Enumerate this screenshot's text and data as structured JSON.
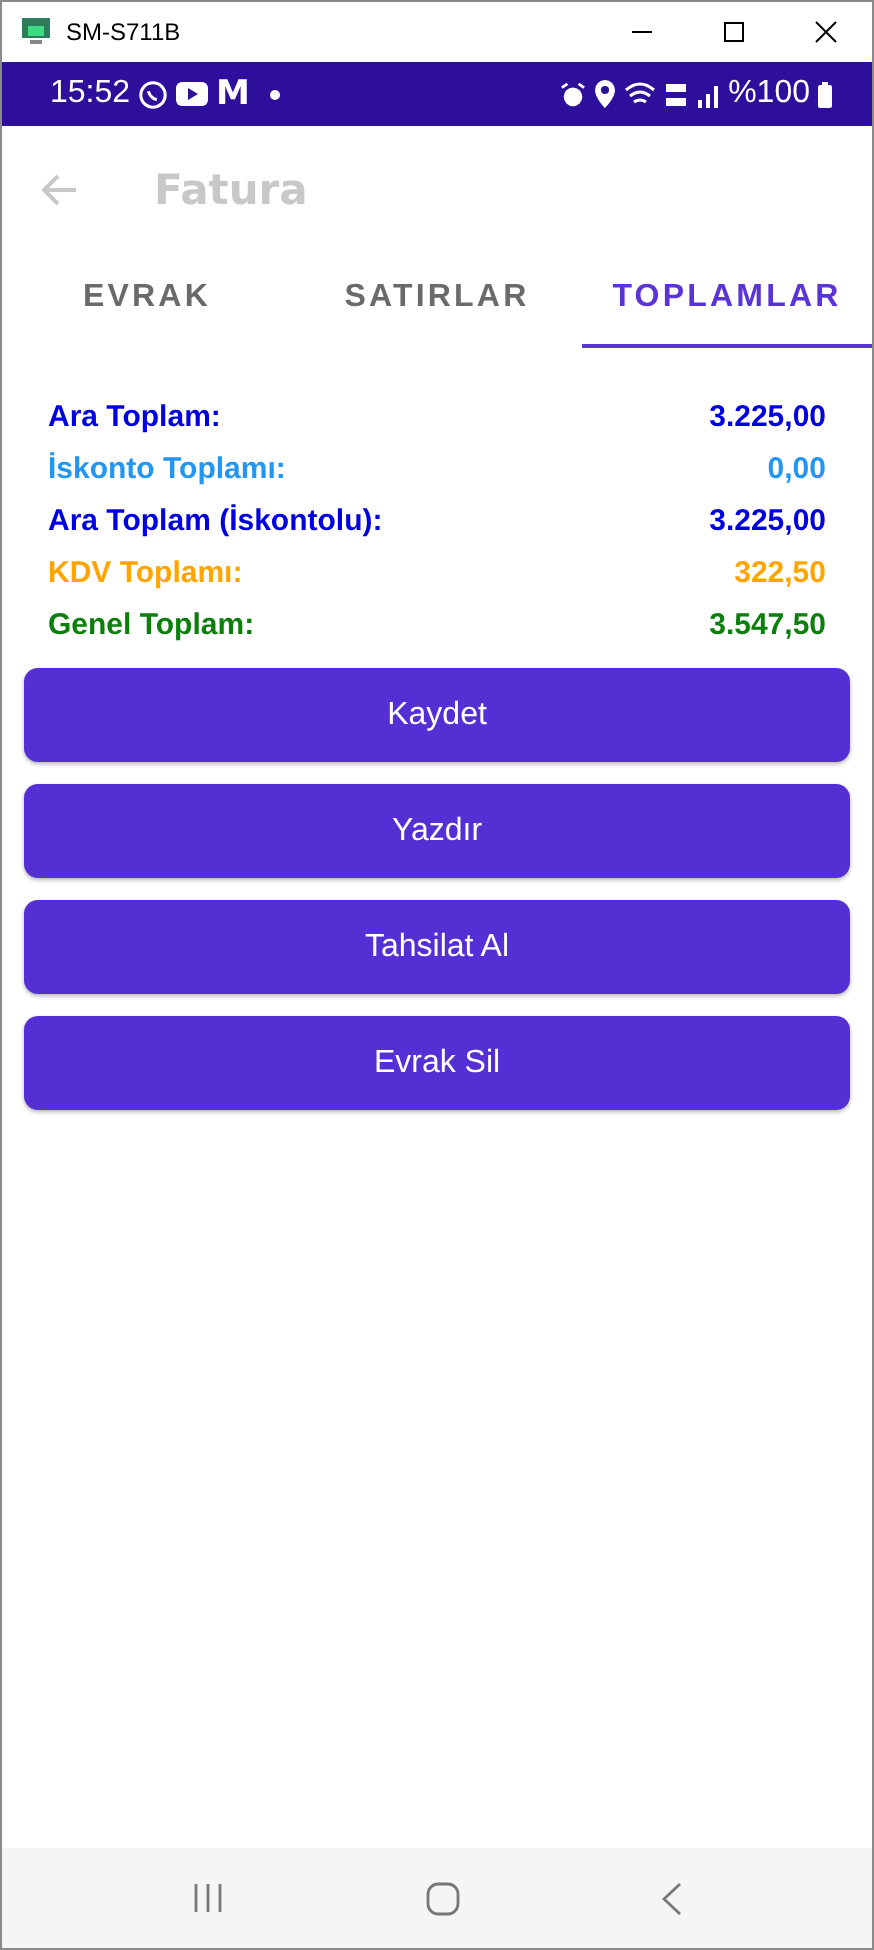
{
  "window": {
    "title": "SM-S711B"
  },
  "status_bar": {
    "time": "15:52",
    "mail_glyph": "M",
    "battery": "%100"
  },
  "app_bar": {
    "title": "Fatura"
  },
  "tabs": [
    {
      "label": "EVRAK",
      "selected": false
    },
    {
      "label": "SATIRLAR",
      "selected": false
    },
    {
      "label": "TOPLAMLAR",
      "selected": true
    }
  ],
  "totals": [
    {
      "label": "Ara Toplam:",
      "value": "3.225,00",
      "color": "#0000e0"
    },
    {
      "label": "İskonto Toplamı:",
      "value": "0,00",
      "color": "#2196f3"
    },
    {
      "label": "Ara Toplam (İskontolu):",
      "value": "3.225,00",
      "color": "#0000e0"
    },
    {
      "label": "KDV Toplamı:",
      "value": "322,50",
      "color": "#ffa500"
    },
    {
      "label": "Genel Toplam:",
      "value": "3.547,50",
      "color": "#0a7f0a"
    }
  ],
  "buttons": [
    "Kaydet",
    "Yazdır",
    "Tahsilat Al",
    "Evrak Sil"
  ]
}
